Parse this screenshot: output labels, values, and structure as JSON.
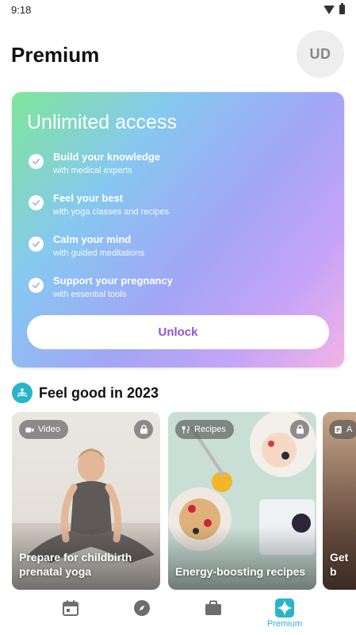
{
  "status_bar": {
    "time": "9:18"
  },
  "header": {
    "title": "Premium",
    "avatar_initials": "UD"
  },
  "promo": {
    "title": "Unlimited access",
    "features": [
      {
        "title": "Build your knowledge",
        "subtitle": "with medical experts"
      },
      {
        "title": "Feel your best",
        "subtitle": "with yoga classes and recipes"
      },
      {
        "title": "Calm your mind",
        "subtitle": "with guided meditations"
      },
      {
        "title": "Support your pregnancy",
        "subtitle": "with essential tools"
      }
    ],
    "button_label": "Unlock"
  },
  "section": {
    "title": "Feel good in 2023"
  },
  "cards": [
    {
      "tag": "Video",
      "title": "Prepare for childbirth prenatal yoga",
      "locked": true,
      "tag_icon": "video-icon"
    },
    {
      "tag": "Recipes",
      "title": "Energy-boosting recipes",
      "locked": true,
      "tag_icon": "fork-knife-icon"
    },
    {
      "tag": "A",
      "title": "Get b",
      "locked": false,
      "tag_icon": "article-icon"
    }
  ],
  "bottom_nav": {
    "items": [
      {
        "icon": "calendar-icon",
        "label": ""
      },
      {
        "icon": "compass-icon",
        "label": ""
      },
      {
        "icon": "briefcase-icon",
        "label": ""
      },
      {
        "icon": "sparkle-icon",
        "label": "Premium"
      }
    ],
    "active_color": "#2bb4c9"
  },
  "colors": {
    "accent": "#2bb4c9",
    "unlock_text": "#8a57d6"
  }
}
